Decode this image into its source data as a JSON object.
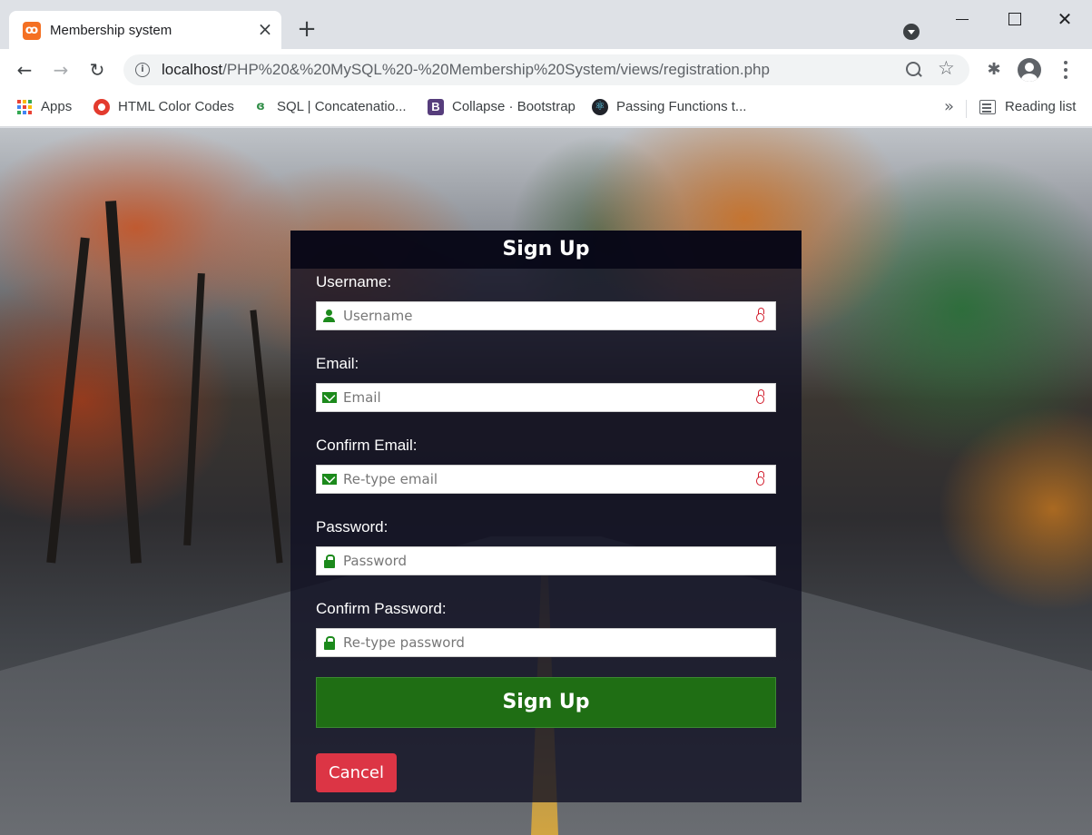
{
  "browser": {
    "tab_title": "Membership system",
    "tab_favicon": "xampp-icon",
    "url_host": "localhost",
    "url_path": "/PHP%20&%20MySQL%20-%20Membership%20System/views/registration.php",
    "bookmarks": [
      {
        "label": "Apps",
        "icon": "apps-grid-icon"
      },
      {
        "label": "HTML Color Codes",
        "icon": "html-color-codes-icon"
      },
      {
        "label": "SQL | Concatenatio...",
        "icon": "geeksforgeeks-icon"
      },
      {
        "label": "Collapse · Bootstrap",
        "icon": "bootstrap-icon"
      },
      {
        "label": "Passing Functions t...",
        "icon": "react-icon"
      }
    ],
    "more_bookmarks": "»",
    "reading_list": "Reading list"
  },
  "form": {
    "title": "Sign Up",
    "fields": [
      {
        "label": "Username:",
        "placeholder": "Username",
        "icon": "user-icon",
        "required_marker": true
      },
      {
        "label": "Email:",
        "placeholder": "Email",
        "icon": "envelope-icon",
        "required_marker": true
      },
      {
        "label": "Confirm Email:",
        "placeholder": "Re-type email",
        "icon": "envelope-icon",
        "required_marker": true
      },
      {
        "label": "Password:",
        "placeholder": "Password",
        "icon": "padlock-icon",
        "required_marker": false
      },
      {
        "label": "Confirm Password:",
        "placeholder": "Re-type password",
        "icon": "padlock-icon",
        "required_marker": false
      }
    ],
    "submit_label": "Sign Up",
    "cancel_label": "Cancel"
  },
  "colors": {
    "submit_bg": "#1f6e14",
    "cancel_bg": "#dc3545",
    "icon_green": "#1c8a1c",
    "required_red": "#d11a2a"
  }
}
